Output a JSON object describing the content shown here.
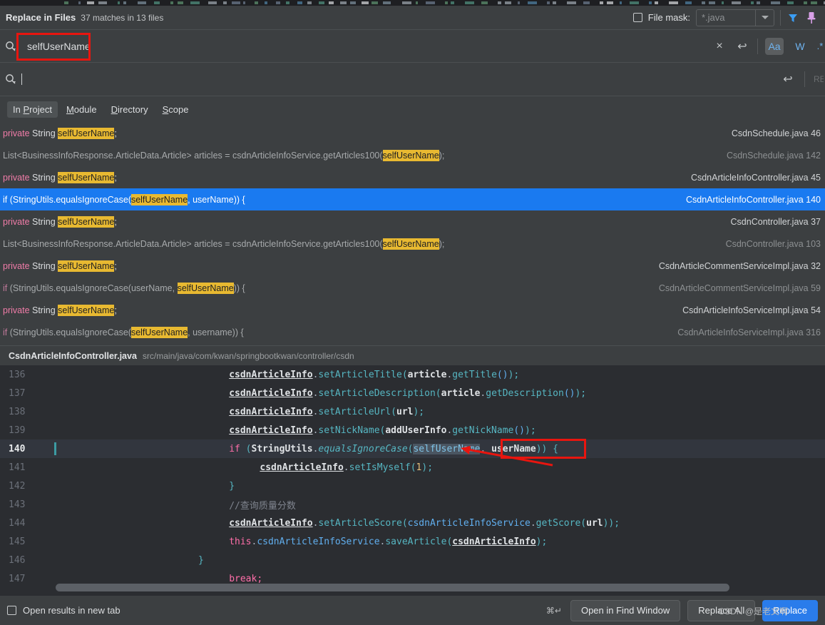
{
  "header": {
    "title": "Replace in Files",
    "subtitle": "37 matches in 13 files",
    "file_mask_label": "File mask:",
    "file_mask_value": "*.java"
  },
  "search": {
    "value": "selfUserName",
    "clear_label": "×",
    "history_label": "↩",
    "match_case_label": "Aa",
    "words_label": "W",
    "regex_label": ".*"
  },
  "replace": {
    "value": "",
    "history_label": "↩",
    "clipped_label": "RE"
  },
  "scope": {
    "tabs": [
      {
        "pre": "In ",
        "mnemonic": "P",
        "post": "roject",
        "active": true
      },
      {
        "pre": "",
        "mnemonic": "M",
        "post": "odule",
        "active": false
      },
      {
        "pre": "",
        "mnemonic": "D",
        "post": "irectory",
        "active": false
      },
      {
        "pre": "",
        "mnemonic": "S",
        "post": "cope",
        "active": false
      }
    ]
  },
  "results": [
    {
      "segments": [
        {
          "t": "private ",
          "c": "kw"
        },
        {
          "t": "String ",
          "c": "pl"
        },
        {
          "t": "selfUserName",
          "c": "hl"
        },
        {
          "t": ";",
          "c": "pl"
        }
      ],
      "file": "CsdnSchedule.java 46",
      "dim": false,
      "selected": false
    },
    {
      "segments": [
        {
          "t": "List<BusinessInfoResponse.ArticleData.Article> articles = csdnArticleInfoService.getArticles100(",
          "c": "pl"
        },
        {
          "t": "selfUserName",
          "c": "hl"
        },
        {
          "t": ");",
          "c": "pl"
        }
      ],
      "file": "CsdnSchedule.java 142",
      "dim": true,
      "selected": false
    },
    {
      "segments": [
        {
          "t": "private ",
          "c": "kw"
        },
        {
          "t": "String ",
          "c": "pl"
        },
        {
          "t": "selfUserName",
          "c": "hl"
        },
        {
          "t": ";",
          "c": "pl"
        }
      ],
      "file": "CsdnArticleInfoController.java 45",
      "dim": false,
      "selected": false
    },
    {
      "segments": [
        {
          "t": "if ",
          "c": "kw"
        },
        {
          "t": "(StringUtils.equalsIgnoreCase(",
          "c": "pl"
        },
        {
          "t": "selfUserName",
          "c": "hl"
        },
        {
          "t": ", userName)) {",
          "c": "pl"
        }
      ],
      "file": "CsdnArticleInfoController.java 140",
      "dim": false,
      "selected": true
    },
    {
      "segments": [
        {
          "t": "private ",
          "c": "kw"
        },
        {
          "t": "String ",
          "c": "pl"
        },
        {
          "t": "selfUserName",
          "c": "hl"
        },
        {
          "t": ";",
          "c": "pl"
        }
      ],
      "file": "CsdnController.java 37",
      "dim": false,
      "selected": false
    },
    {
      "segments": [
        {
          "t": "List<BusinessInfoResponse.ArticleData.Article> articles = csdnArticleInfoService.getArticles100(",
          "c": "pl"
        },
        {
          "t": "selfUserName",
          "c": "hl"
        },
        {
          "t": ");",
          "c": "pl"
        }
      ],
      "file": "CsdnController.java 103",
      "dim": true,
      "selected": false
    },
    {
      "segments": [
        {
          "t": "private ",
          "c": "kw"
        },
        {
          "t": "String ",
          "c": "pl"
        },
        {
          "t": "selfUserName",
          "c": "hl"
        },
        {
          "t": ";",
          "c": "pl"
        }
      ],
      "file": "CsdnArticleCommentServiceImpl.java 32",
      "dim": false,
      "selected": false
    },
    {
      "segments": [
        {
          "t": "if ",
          "c": "kw"
        },
        {
          "t": "(StringUtils.equalsIgnoreCase(userName, ",
          "c": "pl"
        },
        {
          "t": "selfUserName",
          "c": "hl"
        },
        {
          "t": ")) {",
          "c": "pl"
        }
      ],
      "file": "CsdnArticleCommentServiceImpl.java 59",
      "dim": true,
      "selected": false
    },
    {
      "segments": [
        {
          "t": "private ",
          "c": "kw"
        },
        {
          "t": "String ",
          "c": "pl"
        },
        {
          "t": "selfUserName",
          "c": "hl"
        },
        {
          "t": ";",
          "c": "pl"
        }
      ],
      "file": "CsdnArticleInfoServiceImpl.java 54",
      "dim": false,
      "selected": false
    },
    {
      "segments": [
        {
          "t": "if ",
          "c": "kw"
        },
        {
          "t": "(StringUtils.equalsIgnoreCase(",
          "c": "pl"
        },
        {
          "t": "selfUserName",
          "c": "hl"
        },
        {
          "t": ", username)) {",
          "c": "pl"
        }
      ],
      "file": "CsdnArticleInfoServiceImpl.java 316",
      "dim": true,
      "selected": false
    }
  ],
  "preview_header": {
    "file": "CsdnArticleInfoController.java",
    "path": "src/main/java/com/kwan/springbootkwan/controller/csdn"
  },
  "code_lines": [
    {
      "num": "136",
      "indent": 24,
      "current": false,
      "tokens": [
        {
          "t": "csdnArticleInfo",
          "c": "c-var"
        },
        {
          "t": ".",
          "c": "c-pun"
        },
        {
          "t": "setArticleTitle",
          "c": "c-meth"
        },
        {
          "t": "(",
          "c": "c-par"
        },
        {
          "t": "article",
          "c": "c-varp"
        },
        {
          "t": ".",
          "c": "c-pun"
        },
        {
          "t": "getTitle",
          "c": "c-meth"
        },
        {
          "t": "()",
          "c": "c-meth2"
        },
        {
          "t": ");",
          "c": "c-par"
        }
      ]
    },
    {
      "num": "137",
      "indent": 24,
      "current": false,
      "tokens": [
        {
          "t": "csdnArticleInfo",
          "c": "c-var"
        },
        {
          "t": ".",
          "c": "c-pun"
        },
        {
          "t": "setArticleDescription",
          "c": "c-meth"
        },
        {
          "t": "(",
          "c": "c-par"
        },
        {
          "t": "article",
          "c": "c-varp"
        },
        {
          "t": ".",
          "c": "c-pun"
        },
        {
          "t": "getDescription",
          "c": "c-meth"
        },
        {
          "t": "()",
          "c": "c-meth2"
        },
        {
          "t": ");",
          "c": "c-par"
        }
      ]
    },
    {
      "num": "138",
      "indent": 24,
      "current": false,
      "tokens": [
        {
          "t": "csdnArticleInfo",
          "c": "c-var"
        },
        {
          "t": ".",
          "c": "c-pun"
        },
        {
          "t": "setArticleUrl",
          "c": "c-meth"
        },
        {
          "t": "(",
          "c": "c-par"
        },
        {
          "t": "url",
          "c": "c-varp"
        },
        {
          "t": ");",
          "c": "c-par"
        }
      ]
    },
    {
      "num": "139",
      "indent": 24,
      "current": false,
      "tokens": [
        {
          "t": "csdnArticleInfo",
          "c": "c-var"
        },
        {
          "t": ".",
          "c": "c-pun"
        },
        {
          "t": "setNickName",
          "c": "c-meth"
        },
        {
          "t": "(",
          "c": "c-par"
        },
        {
          "t": "addUserInfo",
          "c": "c-varp"
        },
        {
          "t": ".",
          "c": "c-pun"
        },
        {
          "t": "getNickName",
          "c": "c-meth"
        },
        {
          "t": "()",
          "c": "c-meth2"
        },
        {
          "t": ");",
          "c": "c-par"
        }
      ]
    },
    {
      "num": "140",
      "indent": 24,
      "current": true,
      "tokens": [
        {
          "t": "if ",
          "c": "c-kw"
        },
        {
          "t": "(",
          "c": "c-par"
        },
        {
          "t": "StringUtils",
          "c": "c-varp"
        },
        {
          "t": ".",
          "c": "c-pun"
        },
        {
          "t": "equalsIgnoreCase",
          "c": "c-ital"
        },
        {
          "t": "(",
          "c": "c-par"
        },
        {
          "t": "selfUserName",
          "c": "c-sel"
        },
        {
          "t": ", ",
          "c": "c-pun"
        },
        {
          "t": "userName",
          "c": "c-varp"
        },
        {
          "t": "))",
          "c": "c-par"
        },
        {
          "t": " {",
          "c": "c-par"
        }
      ]
    },
    {
      "num": "141",
      "indent": 28,
      "current": false,
      "tokens": [
        {
          "t": "csdnArticleInfo",
          "c": "c-var"
        },
        {
          "t": ".",
          "c": "c-pun"
        },
        {
          "t": "setIsMyself",
          "c": "c-meth"
        },
        {
          "t": "(",
          "c": "c-par"
        },
        {
          "t": "1",
          "c": "c-num"
        },
        {
          "t": ");",
          "c": "c-par"
        }
      ]
    },
    {
      "num": "142",
      "indent": 24,
      "current": false,
      "tokens": [
        {
          "t": "}",
          "c": "c-par"
        }
      ]
    },
    {
      "num": "143",
      "indent": 24,
      "current": false,
      "tokens": [
        {
          "t": "//查询质量分数",
          "c": "c-cmt"
        }
      ]
    },
    {
      "num": "144",
      "indent": 24,
      "current": false,
      "tokens": [
        {
          "t": "csdnArticleInfo",
          "c": "c-var"
        },
        {
          "t": ".",
          "c": "c-pun"
        },
        {
          "t": "setArticleScore",
          "c": "c-meth"
        },
        {
          "t": "(",
          "c": "c-par"
        },
        {
          "t": "csdnArticleInfoService",
          "c": "c-meth2"
        },
        {
          "t": ".",
          "c": "c-pun"
        },
        {
          "t": "getScore",
          "c": "c-meth"
        },
        {
          "t": "(",
          "c": "c-par"
        },
        {
          "t": "url",
          "c": "c-varp"
        },
        {
          "t": "));",
          "c": "c-par"
        }
      ]
    },
    {
      "num": "145",
      "indent": 24,
      "current": false,
      "tokens": [
        {
          "t": "this",
          "c": "c-kw"
        },
        {
          "t": ".",
          "c": "c-pun"
        },
        {
          "t": "csdnArticleInfoService",
          "c": "c-meth2"
        },
        {
          "t": ".",
          "c": "c-pun"
        },
        {
          "t": "saveArticle",
          "c": "c-meth"
        },
        {
          "t": "(",
          "c": "c-par"
        },
        {
          "t": "csdnArticleInfo",
          "c": "c-var"
        },
        {
          "t": ");",
          "c": "c-par"
        }
      ]
    },
    {
      "num": "146",
      "indent": 20,
      "current": false,
      "tokens": [
        {
          "t": "}",
          "c": "c-par"
        }
      ]
    },
    {
      "num": "147",
      "indent": 24,
      "current": false,
      "tokens": [
        {
          "t": "break;",
          "c": "c-kw"
        }
      ]
    }
  ],
  "bottom": {
    "open_results_label": "Open results in new tab",
    "shortcut": "⌘↵",
    "open_find_window": "Open in Find Window",
    "replace_all": "Replace All",
    "replace": "Replace",
    "watermark": "CSDN @是老文啊"
  }
}
